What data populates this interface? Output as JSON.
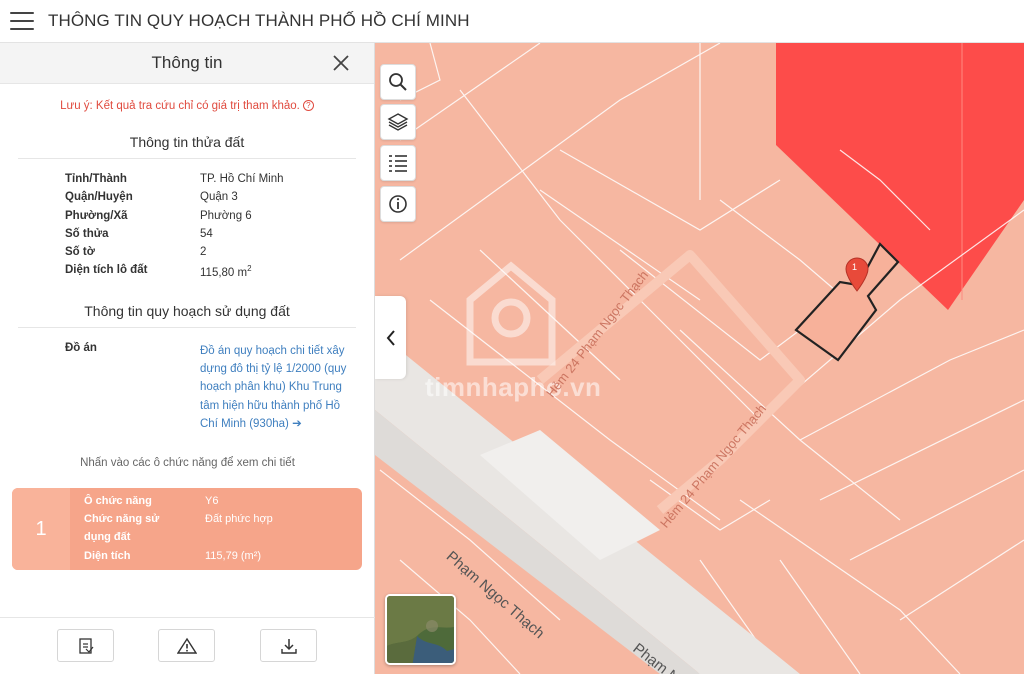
{
  "app": {
    "title": "THÔNG TIN QUY HOẠCH THÀNH PHỐ HỒ CHÍ MINH"
  },
  "panel": {
    "title": "Thông tin",
    "note": "Lưu ý: Kết quả tra cứu chỉ có giá trị tham khảo.",
    "parcel_section_title": "Thông tin thửa đất",
    "parcel": [
      {
        "label": "Tỉnh/Thành",
        "value": "TP. Hồ Chí Minh"
      },
      {
        "label": "Quận/Huyện",
        "value": "Quận 3"
      },
      {
        "label": "Phường/Xã",
        "value": "Phường 6"
      },
      {
        "label": "Số thửa",
        "value": "54"
      },
      {
        "label": "Số tờ",
        "value": "2"
      },
      {
        "label": "Diện tích lô đất",
        "value": "115,80 m"
      }
    ],
    "area_unit_sup": "2",
    "planning_section_title": "Thông tin quy hoạch sử dụng đất",
    "doan_label": "Đồ án",
    "doan_value": "Đồ án quy hoạch chi tiết xây dựng đô thị tỷ lệ 1/2000 (quy hoạch phân khu) Khu Trung tâm hiện hữu thành phố Hồ Chí Minh (930ha)",
    "hint": "Nhấn vào các ô chức năng để xem chi tiết",
    "card": {
      "number": "1",
      "rows": [
        {
          "label": "Ô chức năng",
          "value": "Y6"
        },
        {
          "label": "Chức năng sử dụng đất",
          "value": "Đất phức hợp"
        },
        {
          "label": "Diện tích",
          "value": "115,79 (m²)"
        }
      ]
    }
  },
  "map": {
    "watermark": "timnhapho.vn",
    "marker_label": "1",
    "streets": [
      "Phạm Ngọc Thạch",
      "Hẻm 24 Phạm Ngọc Thạch",
      "Hẻm 24 Phạm Ngọc Thạch",
      "Phạm N"
    ],
    "colors": {
      "parcel": "#f6b7a1",
      "zone": "#fd4c4a",
      "road": "#e9e6e3",
      "parcel_border": "#ffffff"
    }
  }
}
